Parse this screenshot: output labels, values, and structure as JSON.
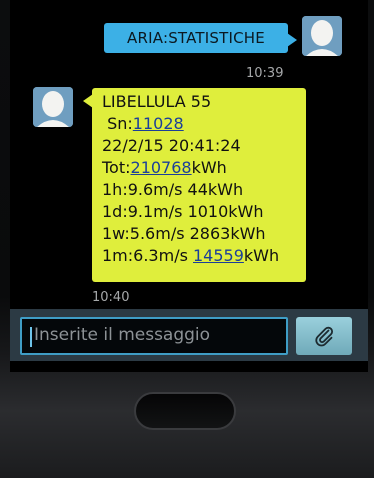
{
  "conversation": {
    "sent": {
      "text": "ARIA:STATISTICHE",
      "time": "10:39"
    },
    "received": {
      "lines": [
        "LIBELLULA 55",
        " Sn:",
        "22/2/15 20:41:24",
        "Tot:",
        "1h:9.6m/s 44kWh",
        "1d:9.1m/s 1010kWh",
        "1w:5.6m/s 2863kWh",
        "1m:6.3m/s "
      ],
      "serial_link": "11028",
      "total_link": "210768",
      "total_unit": "kWh",
      "month_link": "14559",
      "month_unit": "kWh",
      "time": "10:40"
    }
  },
  "composer": {
    "placeholder": "Inserite il messaggio",
    "attach_icon": "paperclip-icon"
  },
  "colors": {
    "sent_bubble": "#3cb0e6",
    "received_bubble": "#dfee3c",
    "input_border": "#3f9dc6"
  }
}
